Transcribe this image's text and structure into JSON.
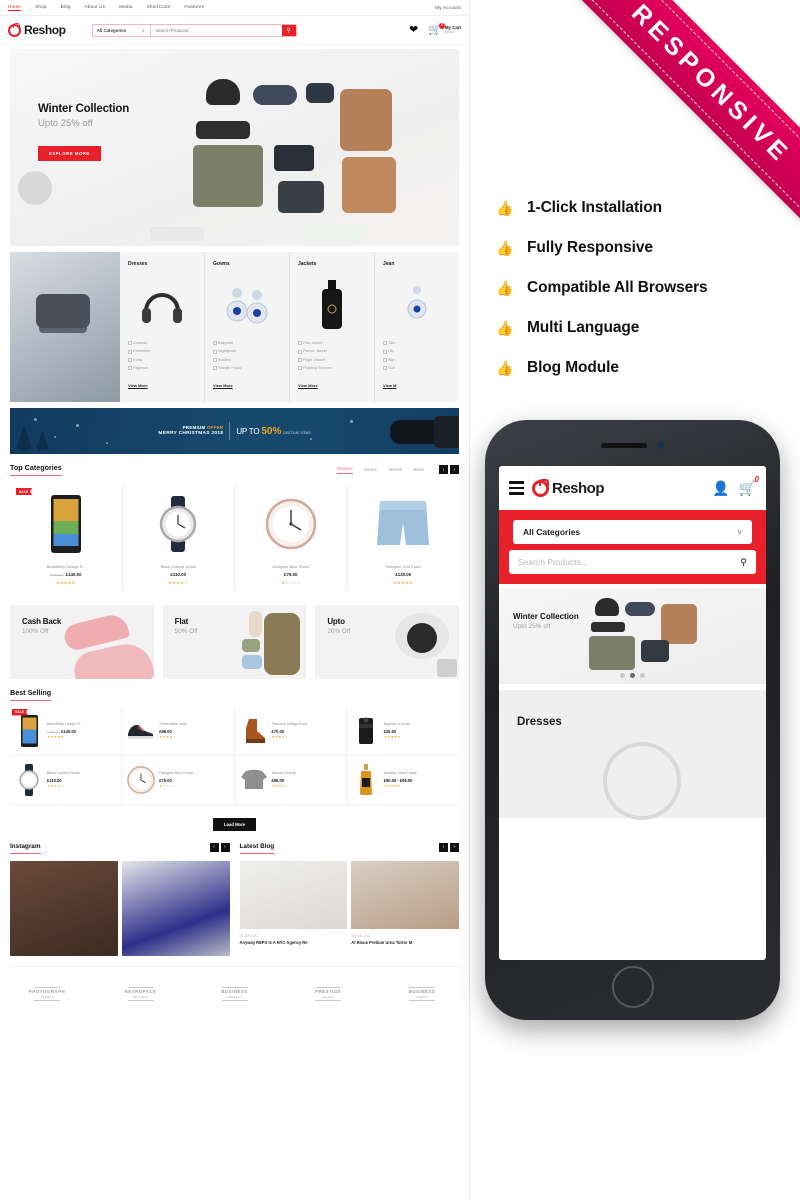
{
  "desktop": {
    "topbar": {
      "menu": [
        "Home",
        "Shop",
        "Blog",
        "About Us",
        "Media",
        "ShortCode",
        "Features"
      ],
      "account": "My Account"
    },
    "header": {
      "logo": "Reshop",
      "category_select": "All Categories",
      "search_placeholder": "Search Products...",
      "search_icon": "search-icon",
      "wishlist_icon": "heart-icon",
      "cart_icon": "cart-icon",
      "cart_badge": "0",
      "cart_label": "My Cart",
      "cart_total": "£0.00"
    },
    "hero": {
      "title": "Winter Collection",
      "subtitle": "Upto 25% off",
      "cta": "EXPLORE MORE"
    },
    "category_strip": [
      {
        "title": "Dresses",
        "links": [
          "Anarkali",
          "Parineeta",
          "Kurta",
          "Pajamas"
        ],
        "more": "View More"
      },
      {
        "title": "Gowns",
        "links": [
          "Babydoll",
          "Nightgown",
          "Bustled",
          "Sheath Frock"
        ],
        "more": "View More"
      },
      {
        "title": "Jackets",
        "links": [
          "Flak Jacket",
          "Fleece Jacket",
          "Flight Jacket",
          "Floating Sleeves"
        ],
        "more": "View More"
      },
      {
        "title": "Jean",
        "links": [
          "Slim",
          "Hip",
          "Skin",
          "Suit"
        ],
        "more": "View M"
      }
    ],
    "xmas_banner": {
      "line1_a": "PREMIUM ",
      "line1_b": "OFFER",
      "line2": "MERRY CHRISTMAS 2018",
      "upto": "UP TO",
      "percent": "50%",
      "small": "DISCOUNT ITEMS"
    },
    "top_categories": {
      "title": "Top Categories",
      "tabs": [
        "Dresses",
        "Gowns",
        "Jackets",
        "Jeans"
      ],
      "active_tab": "Dresses",
      "prev_icon": "chevron-left-icon",
      "next_icon": "chevron-right-icon",
      "products": [
        {
          "badge": "SALE",
          "name": "Beautifully Design R..",
          "old_price": "£180.00",
          "price": "£140.00",
          "stars": 5
        },
        {
          "badge": "",
          "name": "Black Lowest Jeans",
          "old_price": "",
          "price": "£110.00",
          "stars": 4
        },
        {
          "badge": "",
          "name": "Designer Blue Dress",
          "old_price": "",
          "price": "£75.00",
          "stars": 1
        },
        {
          "badge": "",
          "name": "Designer Suit Court",
          "old_price": "",
          "price": "£120.00",
          "stars": 5
        }
      ]
    },
    "promos": [
      {
        "title": "Cash Back",
        "sub": "100% Off"
      },
      {
        "title": "Flat",
        "sub": "50% Off"
      },
      {
        "title": "Upto",
        "sub": "20% Off"
      }
    ],
    "best_selling": {
      "title": "Best Selling",
      "load_more": "Load More",
      "products": [
        {
          "badge": "SALE",
          "name": "Beautifully Design R..",
          "old_price": "£180.00",
          "price": "£140.00",
          "stars": 5
        },
        {
          "badge": "",
          "name": "Stretchable Jean",
          "old_price": "",
          "price": "£98.00",
          "stars": 4
        },
        {
          "badge": "",
          "name": "Peacock Design Kurti",
          "old_price": "",
          "price": "£70.00",
          "stars": 4
        },
        {
          "badge": "",
          "name": "Daphne In Scarf",
          "old_price": "",
          "price": "£35.00",
          "stars": 5
        },
        {
          "badge": "",
          "name": "Black Lowest Jeans",
          "old_price": "",
          "price": "£110.00",
          "stars": 4
        },
        {
          "badge": "",
          "name": "Designer Blue Dress",
          "old_price": "",
          "price": "£75.00",
          "stars": 1
        },
        {
          "badge": "",
          "name": "Maroon Shorty",
          "old_price": "",
          "price": "£98.00",
          "stars": 4
        },
        {
          "badge": "",
          "name": "Antique Short Dress",
          "old_price": "",
          "price": "£80.00 - £98.00",
          "stars": 5
        }
      ]
    },
    "instagram": {
      "title": "Instagram"
    },
    "latest_blog": {
      "title": "Latest Blog",
      "posts": [
        {
          "date": "05 JAN 2021",
          "title": "Anyway REPS Is A NYC Agency Re"
        },
        {
          "date": "28 AUG 2018",
          "title": "At Risus Pretium Urna Tortor M"
        }
      ]
    },
    "brands": [
      {
        "name": "PHOTOGRAPH",
        "sub": "STUDIO"
      },
      {
        "name": "RETROPACK",
        "sub": "ORIGINAL"
      },
      {
        "name": "BUSINESS",
        "sub": "COMPANY"
      },
      {
        "name": "PRESTIGE",
        "sub": "Quality"
      },
      {
        "name": "BUSINESS",
        "sub": "AGENCY"
      }
    ]
  },
  "right_panel": {
    "ribbon": "RESPONSIVE",
    "features": [
      {
        "icon": "thumbs-up-icon",
        "label": "1-Click Installation"
      },
      {
        "icon": "thumbs-up-icon",
        "label": "Fully Responsive"
      },
      {
        "icon": "thumbs-up-icon",
        "label": "Compatible All Browsers"
      },
      {
        "icon": "thumbs-up-icon",
        "label": "Multi Language"
      },
      {
        "icon": "thumbs-up-icon",
        "label": "Blog Module"
      }
    ],
    "phone": {
      "menu_icon": "hamburger-icon",
      "logo": "Reshop",
      "user_icon": "user-icon",
      "cart_icon": "cart-icon",
      "cart_badge": "0",
      "category_select": "All Categories",
      "chevron": "chevron-down-icon",
      "search_placeholder": "Search Products...",
      "search_icon": "search-icon",
      "hero_title": "Winter Collection",
      "hero_sub": "Upto 25% off",
      "section_title": "Dresses"
    }
  },
  "colors": {
    "brand_red": "#e8202a",
    "ribbon_pink": "#e6005e",
    "accent_coral": "#ee6b73",
    "star_gold": "#f5a623"
  }
}
